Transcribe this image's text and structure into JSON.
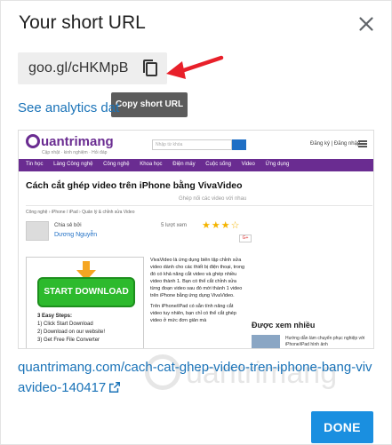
{
  "dialog": {
    "title": "Your short URL",
    "close_icon": "close-icon",
    "short_url": "goo.gl/cHKMpB",
    "copy_icon": "copy-icon",
    "tooltip": "Copy short URL",
    "analytics_link": "See analytics dat",
    "long_url": "quantrimang.com/cach-cat-ghep-video-tren-iphone-bang-vivavideo-140417",
    "external_icon": "external-link-icon",
    "done_label": "DONE",
    "accent_color": "#1a8fe0",
    "link_color": "#1a73b8"
  },
  "preview": {
    "logo": "uantrimang",
    "tagline": "Cập nhật · kinh nghiệm · Hỏi đáp",
    "search_placeholder": "Nhập từ khóa",
    "login": "Đăng ký | Đăng nhập",
    "nav": [
      "Tin học",
      "Làng Công nghệ",
      "Công nghệ",
      "Khoa học",
      "Điện máy",
      "Cuộc sống",
      "Video",
      "Ứng dụng"
    ],
    "headline": "Cách cắt ghép video trên iPhone bằng VivaVideo",
    "subheadline": "Ghép nối các video với nhau",
    "breadcrumbs": "Công nghệ  ›  iPhone / iPad  ›  Quản lý & chỉnh sửa Video",
    "author_label": "Chia sẻ bởi",
    "author_name": "Dương Nguyễn",
    "rating_label": "5 lượt xem",
    "stars": "★★★☆",
    "gplus": "G+",
    "ad_button": "START DOWNLOAD",
    "ad_steps": [
      "3 Easy Steps:",
      "1) Click Start Download",
      "2) Download on our website!",
      "3) Get Free File Converter"
    ],
    "article_text": "VivaVideo là ứng dụng biên tập chỉnh sửa video dành cho các thiết bị điện thoại, trong đó có khả năng cắt video và ghép nhiều video thành 1. Bạn có thể cắt chỉnh sửa từng đoạn video sau đó mới thành 1 video trên iPhone bằng ứng dụng VivaVideo.",
    "article_text2": "Trên iPhone/iPad có sẵn tính năng cắt video tuy nhiên, bạn chỉ có thể cắt ghép video ở mức đơn giản mà",
    "side_title": "Được xem nhiều",
    "side_text": "Hướng dẫn làm chuyển phục nghiệp với iPhone/iPad hình ảnh"
  },
  "watermark": {
    "text": "uantrimang"
  }
}
